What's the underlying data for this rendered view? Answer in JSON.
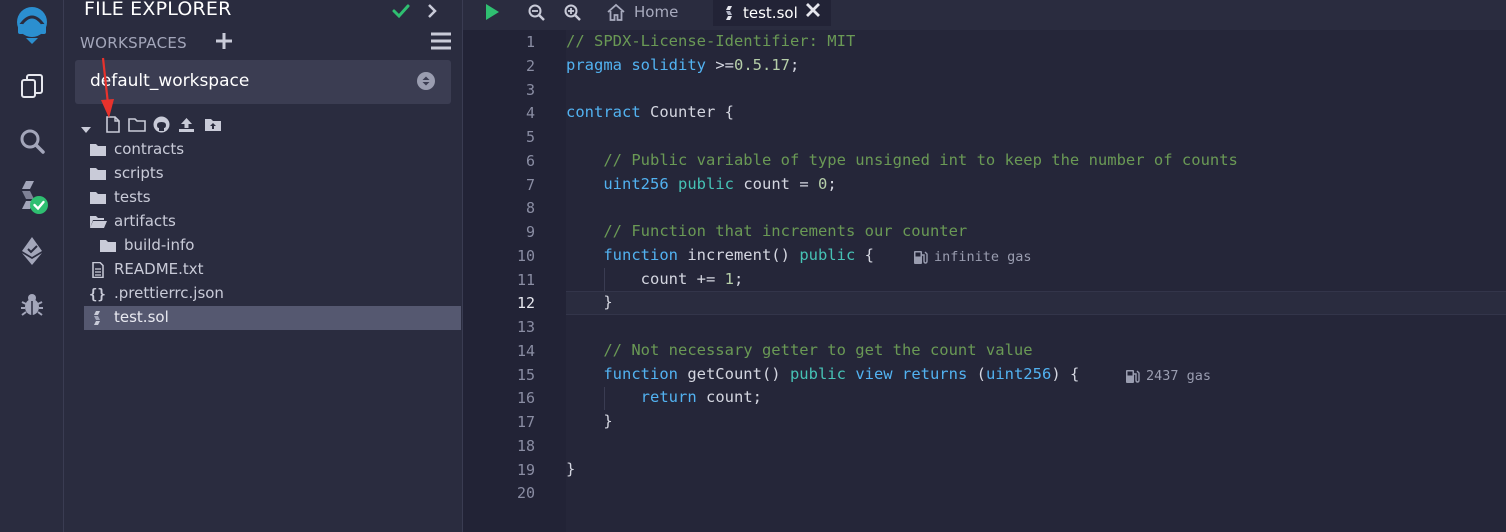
{
  "panel": {
    "title": "FILE EXPLORER",
    "workspaces_label": "WORKSPACES",
    "workspace_selected": "default_workspace"
  },
  "tree": [
    {
      "label": "contracts",
      "icon": "folder-icon"
    },
    {
      "label": "scripts",
      "icon": "folder-icon"
    },
    {
      "label": "tests",
      "icon": "folder-icon"
    },
    {
      "label": "artifacts",
      "icon": "folder-open-icon"
    },
    {
      "label": "build-info",
      "icon": "folder-icon"
    },
    {
      "label": "README.txt",
      "icon": "file-text-icon"
    },
    {
      "label": ".prettierrc.json",
      "icon": "json-braces-icon"
    },
    {
      "label": "test.sol",
      "icon": "solidity-icon"
    }
  ],
  "tabs": {
    "home": "Home",
    "active": "test.sol"
  },
  "editor": {
    "current_line": 12,
    "lines": [
      "// SPDX-License-Identifier: MIT",
      "pragma solidity >=0.5.17;",
      "",
      "contract Counter {",
      "",
      "    // Public variable of type unsigned int to keep the number of counts",
      "    uint256 public count = 0;",
      "",
      "    // Function that increments our counter",
      "    function increment() public {",
      "        count += 1;",
      "    }",
      "",
      "    // Not necessary getter to get the count value",
      "    function getCount() public view returns (uint256) {",
      "        return count;",
      "    }",
      "",
      "}",
      ""
    ],
    "gas_hints": [
      {
        "line": 10,
        "text": "infinite gas"
      },
      {
        "line": 15,
        "text": "2437 gas"
      }
    ]
  },
  "colors": {
    "accent_green": "#2fbf71",
    "comment": "#6a9955",
    "keyword": "#52b2f1"
  }
}
